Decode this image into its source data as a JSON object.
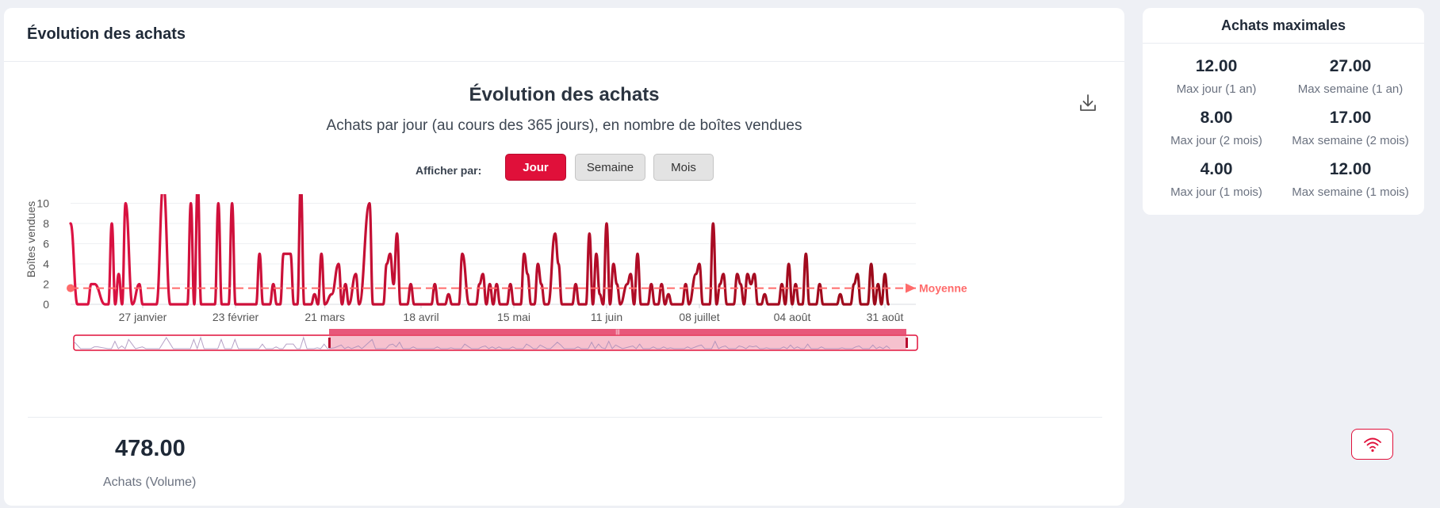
{
  "main_card": {
    "title": "Évolution des achats"
  },
  "chart_header": {
    "title": "Évolution des achats",
    "subtitle": "Achats par jour (au cours des 365 jours), en nombre de boîtes vendues",
    "download_icon": "download-icon"
  },
  "controls": {
    "label": "Afficher par:",
    "buttons": [
      "Jour",
      "Semaine",
      "Mois"
    ],
    "active": "Jour"
  },
  "colors": {
    "accent": "#e0103a",
    "line_start": "#dc1243",
    "line_end": "#9b0a1a",
    "average": "#ff6b6b",
    "navigator": "#e8577a"
  },
  "chart_data": {
    "type": "line",
    "title": "Évolution des achats",
    "subtitle": "Achats par jour (au cours des 365 jours), en nombre de boîtes vendues",
    "ylabel": "Boîtes vendues",
    "ylim": [
      0,
      12
    ],
    "yticks": [
      0,
      2,
      4,
      6,
      8,
      10,
      12
    ],
    "xticks": [
      "27 janvier",
      "23 février",
      "21 mars",
      "18 avril",
      "15 mai",
      "11 juin",
      "08 juillet",
      "04 août",
      "31 août"
    ],
    "xtick_days": [
      27,
      54,
      80,
      108,
      135,
      162,
      189,
      216,
      243
    ],
    "x_range_days": [
      6,
      252
    ],
    "average": {
      "label": "Moyenne",
      "value": 1.6
    },
    "grid": true,
    "series": [
      {
        "points": [
          [
            6,
            8
          ],
          [
            8,
            0
          ],
          [
            11,
            0
          ],
          [
            12,
            2
          ],
          [
            13,
            2
          ],
          [
            16,
            0
          ],
          [
            17,
            0
          ],
          [
            18,
            8
          ],
          [
            19,
            0
          ],
          [
            20,
            3
          ],
          [
            21,
            0
          ],
          [
            22,
            10
          ],
          [
            24,
            0
          ],
          [
            26,
            2
          ],
          [
            27,
            0
          ],
          [
            31,
            0
          ],
          [
            33,
            12
          ],
          [
            35,
            0
          ],
          [
            40,
            0
          ],
          [
            41,
            10
          ],
          [
            42,
            0
          ],
          [
            43,
            12
          ],
          [
            44,
            0
          ],
          [
            48,
            0
          ],
          [
            49,
            10
          ],
          [
            50,
            0
          ],
          [
            52,
            0
          ],
          [
            53,
            10
          ],
          [
            54,
            0
          ],
          [
            60,
            0
          ],
          [
            61,
            5
          ],
          [
            62,
            0
          ],
          [
            64,
            0
          ],
          [
            65,
            2
          ],
          [
            66,
            0
          ],
          [
            67,
            0
          ],
          [
            68,
            5
          ],
          [
            70,
            5
          ],
          [
            71,
            0
          ],
          [
            72,
            0
          ],
          [
            73,
            12
          ],
          [
            74,
            0
          ],
          [
            76,
            0
          ],
          [
            77,
            1
          ],
          [
            78,
            0
          ],
          [
            79,
            5
          ],
          [
            80,
            0
          ],
          [
            82,
            1
          ],
          [
            84,
            4
          ],
          [
            85,
            0
          ],
          [
            86,
            2
          ],
          [
            87,
            0
          ],
          [
            89,
            3
          ],
          [
            90,
            0
          ],
          [
            93,
            10
          ],
          [
            94,
            0
          ],
          [
            97,
            0
          ],
          [
            98,
            4
          ],
          [
            99,
            5
          ],
          [
            100,
            2
          ],
          [
            101,
            7
          ],
          [
            102,
            0
          ],
          [
            104,
            0
          ],
          [
            105,
            2
          ],
          [
            106,
            0
          ],
          [
            109,
            0
          ],
          [
            111,
            0
          ],
          [
            112,
            2
          ],
          [
            113,
            0
          ],
          [
            115,
            0
          ],
          [
            116,
            1
          ],
          [
            117,
            0
          ],
          [
            119,
            0
          ],
          [
            120,
            5
          ],
          [
            122,
            0
          ],
          [
            124,
            0
          ],
          [
            125,
            2
          ],
          [
            126,
            3
          ],
          [
            127,
            0
          ],
          [
            128,
            2
          ],
          [
            129,
            0
          ],
          [
            130,
            2
          ],
          [
            131,
            0
          ],
          [
            133,
            0
          ],
          [
            134,
            2
          ],
          [
            135,
            0
          ],
          [
            137,
            0
          ],
          [
            138,
            5
          ],
          [
            139,
            3
          ],
          [
            140,
            0
          ],
          [
            141,
            0
          ],
          [
            142,
            4
          ],
          [
            143,
            2
          ],
          [
            144,
            0
          ],
          [
            145,
            0
          ],
          [
            147,
            7
          ],
          [
            148,
            4
          ],
          [
            149,
            0
          ],
          [
            150,
            0
          ],
          [
            152,
            0
          ],
          [
            153,
            2
          ],
          [
            154,
            0
          ],
          [
            156,
            0
          ],
          [
            157,
            7
          ],
          [
            158,
            0
          ],
          [
            159,
            5
          ],
          [
            160,
            1
          ],
          [
            161,
            0
          ],
          [
            162,
            8
          ],
          [
            163,
            0
          ],
          [
            164,
            4
          ],
          [
            165,
            2
          ],
          [
            166,
            0
          ],
          [
            168,
            2
          ],
          [
            169,
            3
          ],
          [
            170,
            0
          ],
          [
            171,
            5
          ],
          [
            172,
            0
          ],
          [
            174,
            0
          ],
          [
            175,
            2
          ],
          [
            176,
            0
          ],
          [
            177,
            0
          ],
          [
            178,
            2
          ],
          [
            179,
            0
          ],
          [
            180,
            1
          ],
          [
            181,
            0
          ],
          [
            184,
            0
          ],
          [
            185,
            2
          ],
          [
            186,
            0
          ],
          [
            188,
            3
          ],
          [
            189,
            4
          ],
          [
            190,
            0
          ],
          [
            192,
            0
          ],
          [
            193,
            8
          ],
          [
            194,
            0
          ],
          [
            195,
            2
          ],
          [
            196,
            3
          ],
          [
            197,
            0
          ],
          [
            199,
            0
          ],
          [
            200,
            3
          ],
          [
            201,
            2
          ],
          [
            202,
            0
          ],
          [
            203,
            3
          ],
          [
            204,
            2
          ],
          [
            205,
            3
          ],
          [
            206,
            0
          ],
          [
            207,
            0
          ],
          [
            208,
            1
          ],
          [
            209,
            0
          ],
          [
            212,
            0
          ],
          [
            213,
            2
          ],
          [
            214,
            0
          ],
          [
            215,
            4
          ],
          [
            216,
            0
          ],
          [
            217,
            2
          ],
          [
            218,
            0
          ],
          [
            219,
            0
          ],
          [
            220,
            5
          ],
          [
            221,
            0
          ],
          [
            223,
            0
          ],
          [
            224,
            2
          ],
          [
            225,
            0
          ],
          [
            229,
            0
          ],
          [
            230,
            1
          ],
          [
            231,
            0
          ],
          [
            233,
            0
          ],
          [
            234,
            2
          ],
          [
            235,
            3
          ],
          [
            236,
            0
          ],
          [
            238,
            0
          ],
          [
            239,
            4
          ],
          [
            240,
            0
          ],
          [
            241,
            2
          ],
          [
            242,
            0
          ],
          [
            243,
            3
          ],
          [
            244,
            0
          ]
        ]
      }
    ]
  },
  "summary": {
    "value": "478.00",
    "label": "Achats (Volume)"
  },
  "side_card": {
    "title": "Achats maximales",
    "stats": [
      {
        "value": "12.00",
        "label": "Max jour (1 an)"
      },
      {
        "value": "27.00",
        "label": "Max semaine (1 an)"
      },
      {
        "value": "8.00",
        "label": "Max jour (2 mois)"
      },
      {
        "value": "17.00",
        "label": "Max semaine (2 mois)"
      },
      {
        "value": "4.00",
        "label": "Max jour (1 mois)"
      },
      {
        "value": "12.00",
        "label": "Max semaine (1 mois)"
      }
    ]
  },
  "floating_button": {
    "icon": "wifi-icon"
  }
}
